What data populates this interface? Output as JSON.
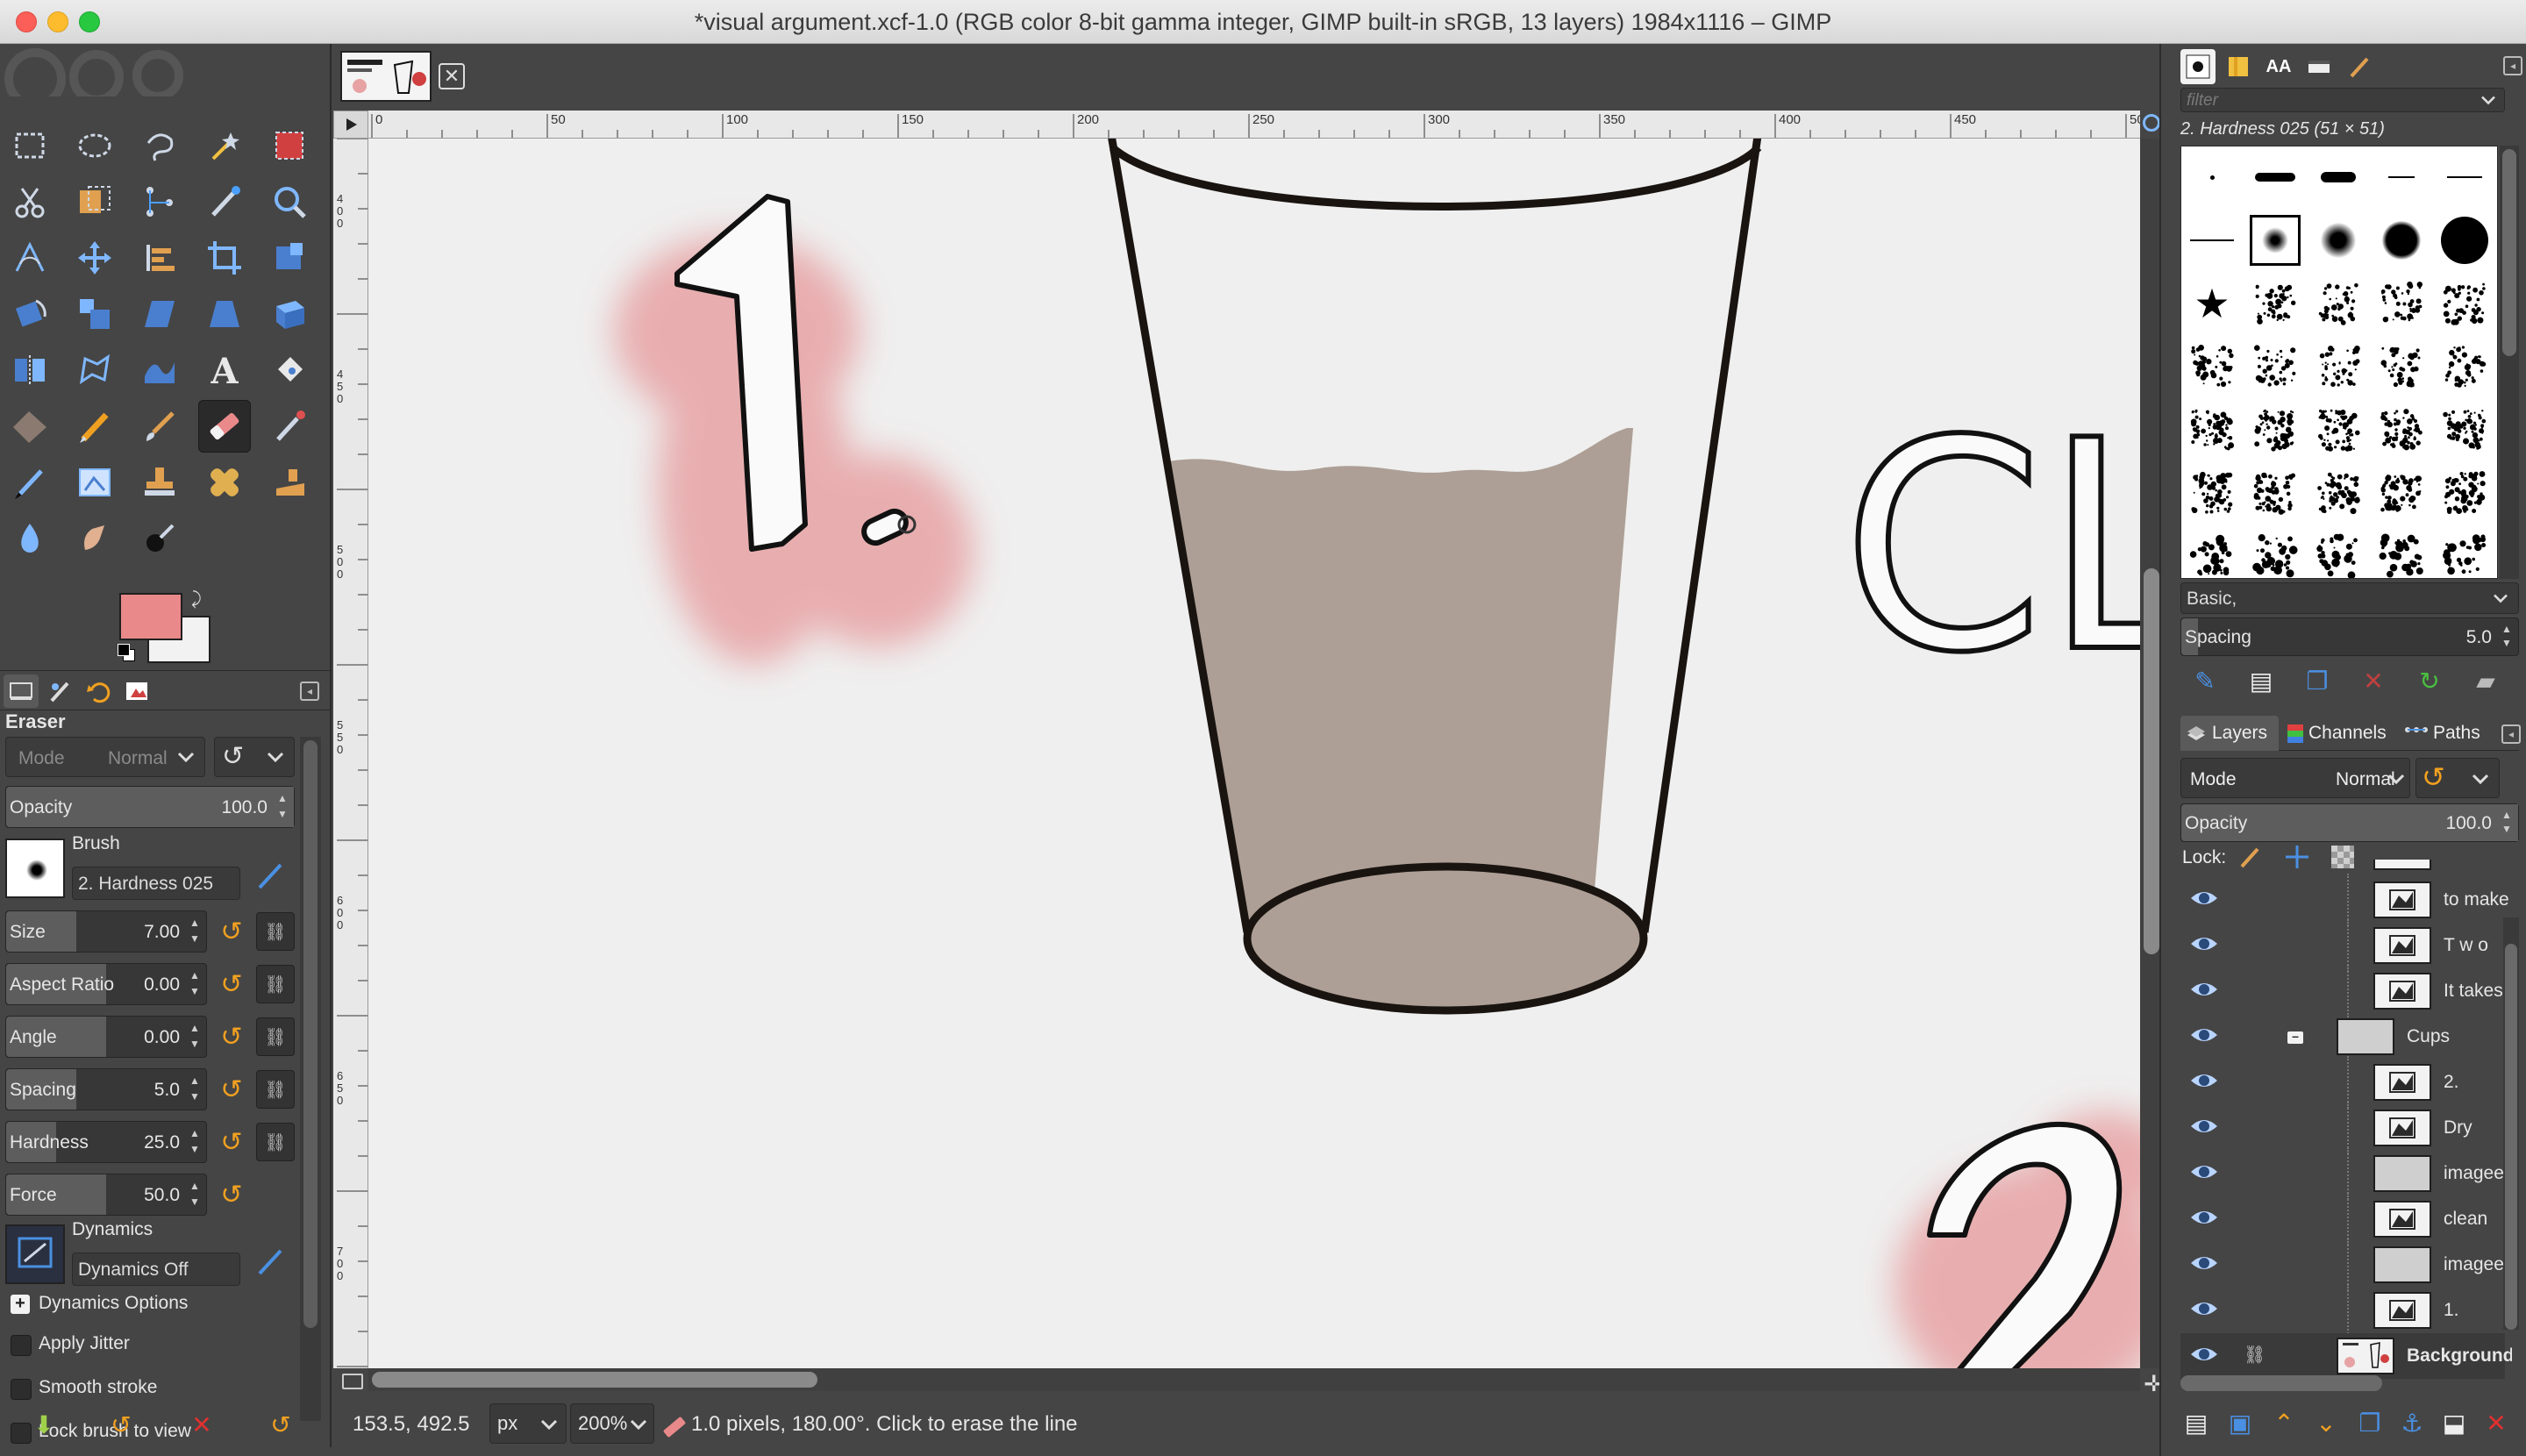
{
  "window": {
    "title": "*visual argument.xcf-1.0 (RGB color 8-bit gamma integer, GIMP built-in sRGB, 13 layers) 1984x1116 – GIMP"
  },
  "tool_options": {
    "title": "Eraser",
    "mode_label": "Mode",
    "mode_value": "Normal",
    "opacity_label": "Opacity",
    "opacity_value": "100.0",
    "brush_label": "Brush",
    "brush_name": "2. Hardness 025",
    "sliders": [
      {
        "label": "Size",
        "value": "7.00",
        "fill": 0.35
      },
      {
        "label": "Aspect Ratio",
        "value": "0.00",
        "fill": 0.5
      },
      {
        "label": "Angle",
        "value": "0.00",
        "fill": 0.5
      },
      {
        "label": "Spacing",
        "value": "5.0",
        "fill": 0.35
      },
      {
        "label": "Hardness",
        "value": "25.0",
        "fill": 0.25
      },
      {
        "label": "Force",
        "value": "50.0",
        "fill": 0.5
      }
    ],
    "dynamics_label": "Dynamics",
    "dynamics_value": "Dynamics Off",
    "dynamics_options": "Dynamics Options",
    "apply_jitter": "Apply Jitter",
    "smooth_stroke": "Smooth stroke",
    "lock_brush": "Lock brush to view"
  },
  "ruler": {
    "ticks": [
      "0",
      "50",
      "100",
      "150",
      "200",
      "250",
      "300",
      "350",
      "400",
      "450",
      "50"
    ]
  },
  "ruler_left": {
    "ticks": [
      "400",
      "450",
      "500",
      "550",
      "600",
      "650",
      "700"
    ]
  },
  "status": {
    "coords": "153.5, 492.5",
    "unit": "px",
    "zoom": "200%",
    "message": "1.0 pixels, 180.00°. Click to erase the line"
  },
  "brushes": {
    "filter_placeholder": "filter",
    "selected": "2. Hardness 025 (51 × 51)",
    "tag": "Basic,",
    "spacing_label": "Spacing",
    "spacing_value": "5.0"
  },
  "layers": {
    "tabs": [
      "Layers",
      "Channels",
      "Paths"
    ],
    "mode_label": "Mode",
    "mode_value": "Normal",
    "opacity_label": "Opacity",
    "opacity_value": "100.0",
    "lock_label": "Lock:",
    "items": [
      {
        "name": "to make a",
        "type": "text"
      },
      {
        "name": "T w o",
        "type": "text"
      },
      {
        "name": "It takes",
        "type": "text"
      },
      {
        "name": "Cups",
        "type": "group"
      },
      {
        "name": "2.",
        "type": "text"
      },
      {
        "name": "Dry",
        "type": "text"
      },
      {
        "name": "imageedit",
        "type": "image"
      },
      {
        "name": "clean",
        "type": "text"
      },
      {
        "name": "imageedit",
        "type": "image"
      },
      {
        "name": "1.",
        "type": "text"
      },
      {
        "name": "Background",
        "type": "background"
      }
    ]
  },
  "canvas_text": {
    "cl": "CL"
  },
  "colors": {
    "foreground": "#e9898a",
    "background": "#f2f2f2",
    "liquid": "#ad9f95",
    "blush": "#e7a3a4"
  }
}
